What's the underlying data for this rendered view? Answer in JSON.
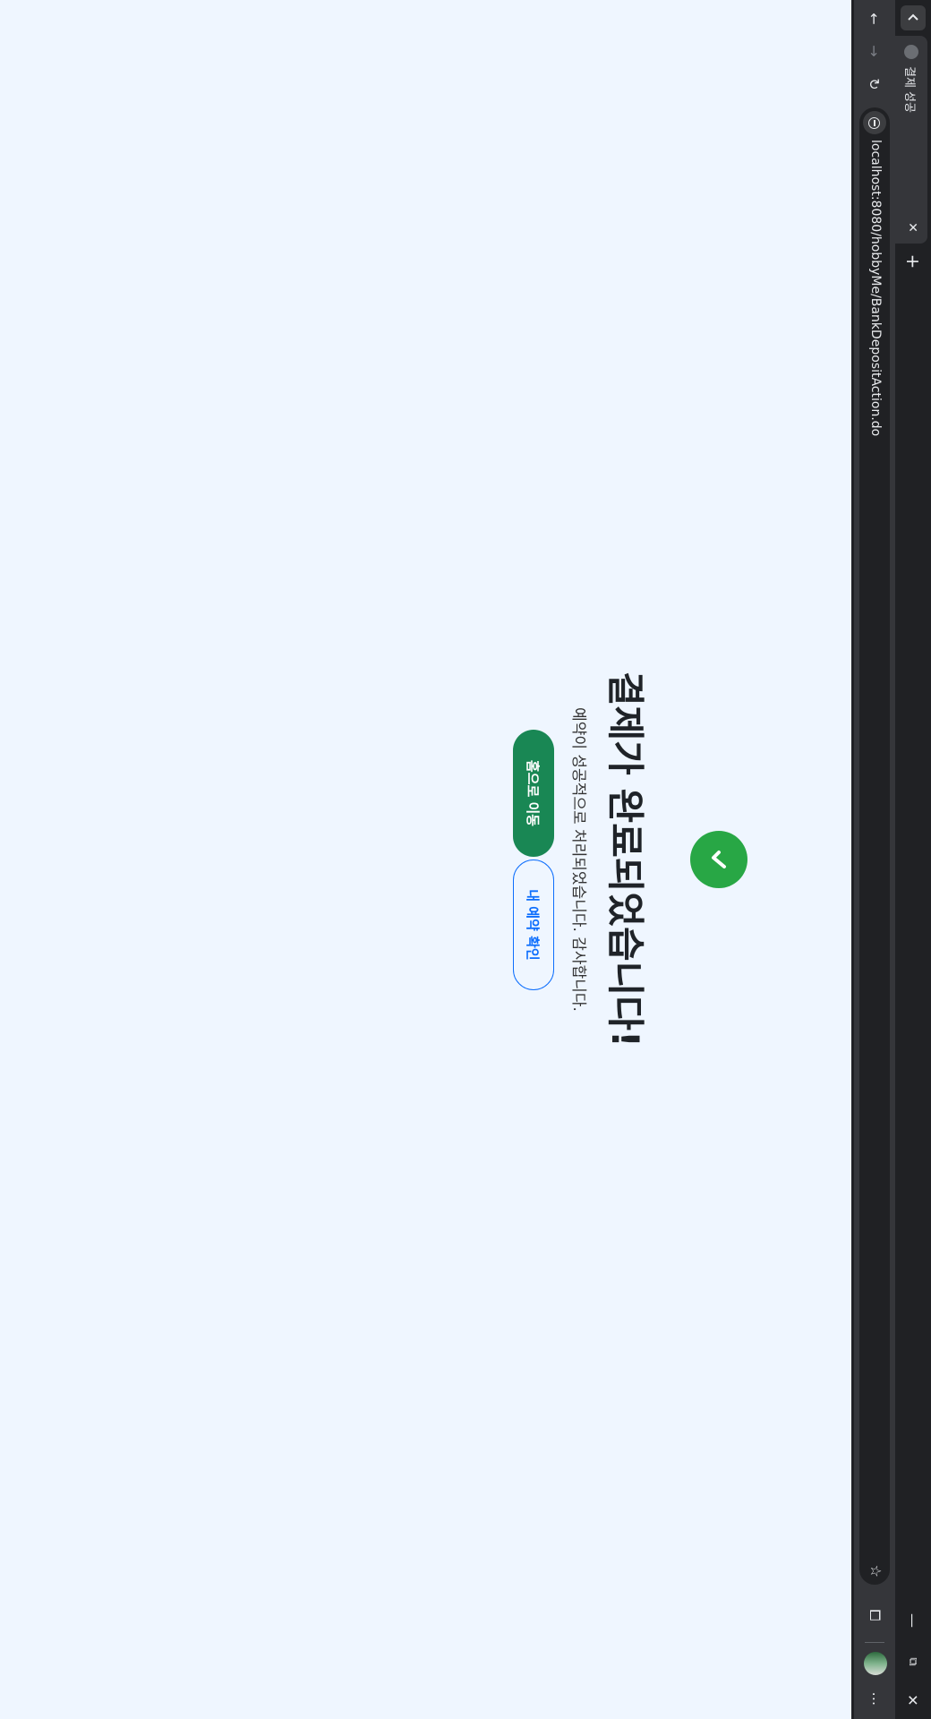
{
  "browser": {
    "tab": {
      "title": "결제 성공",
      "close_glyph": "✕"
    },
    "new_tab_glyph": "+",
    "window_controls": {
      "minimize": "—",
      "restore": "⧉",
      "close": "✕"
    },
    "toolbar": {
      "back_glyph": "←",
      "forward_glyph": "→",
      "reload_glyph": "↻",
      "url": "localhost:8080/hobbyMe/BankDepositAction.do",
      "bookmark_glyph": "☆",
      "extensions_glyph": "⧠",
      "menu_glyph": "⋯"
    }
  },
  "page": {
    "success_icon": "check-icon",
    "title": "결제가 완료되었습니다!",
    "message": "예약이 성공적으로 처리되었습니다. 감사합니다.",
    "home_button_label": "홈으로 이동",
    "my_reservations_button_label": "내 예약 확인"
  },
  "colors": {
    "page_background": "#eff6ff",
    "success_green": "#28a745",
    "home_button": "#198754",
    "outline_blue": "#0d6efd",
    "browser_chrome": "#35363a",
    "tab_strip": "#202124"
  }
}
